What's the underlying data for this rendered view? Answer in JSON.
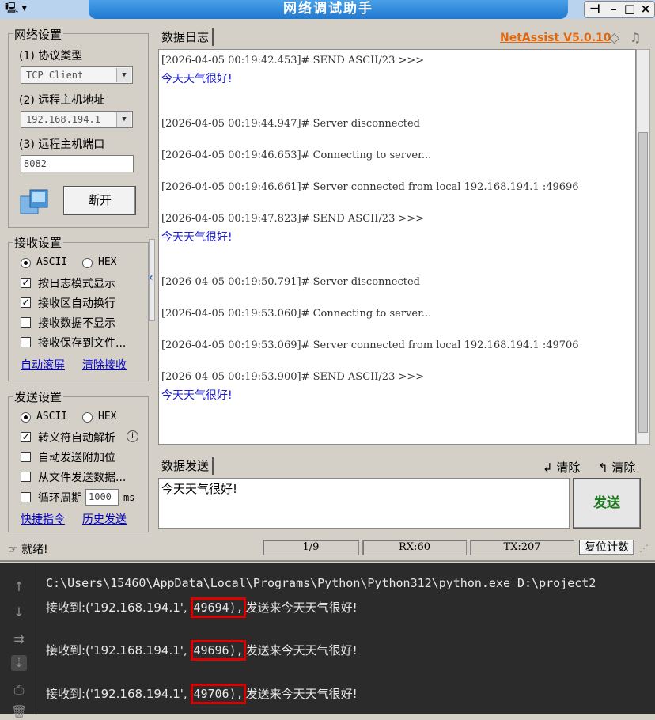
{
  "window": {
    "title": "网络调试助手",
    "brand": "NetAssist V5.0.10",
    "sys_menu": "▾",
    "btn_pin": "⊣",
    "btn_min": "–",
    "btn_max": "□",
    "btn_close": "×"
  },
  "network": {
    "legend": "网络设置",
    "protocol_label": "(1) 协议类型",
    "protocol_value": "TCP Client",
    "host_label": "(2) 远程主机地址",
    "host_value": "192.168.194.1",
    "port_label": "(3) 远程主机端口",
    "port_value": "8082",
    "connect_button": "断开"
  },
  "recv": {
    "legend": "接收设置",
    "radio_ascii": "ASCII",
    "radio_hex": "HEX",
    "opt_log_mode": "按日志模式显示",
    "opt_auto_wrap": "接收区自动换行",
    "opt_hide": "接收数据不显示",
    "opt_save_file": "接收保存到文件...",
    "link_autoscroll": "自动滚屏",
    "link_clear": "清除接收"
  },
  "send_settings": {
    "legend": "发送设置",
    "radio_ascii": "ASCII",
    "radio_hex": "HEX",
    "opt_escape": "转义符自动解析",
    "opt_append": "自动发送附加位",
    "opt_from_file": "从文件发送数据...",
    "opt_loop": "循环周期",
    "loop_value": "1000",
    "loop_unit": "ms",
    "link_shortcuts": "快捷指令",
    "link_history": "历史发送"
  },
  "log": {
    "tab": "数据日志",
    "entries": [
      {
        "meta": "[2026-04-05 00:19:42.453]# SEND ASCII/23 >>>",
        "msg": "今天天气很好!"
      },
      {
        "meta": "[2026-04-05 00:19:44.947]# Server disconnected"
      },
      {
        "meta": "[2026-04-05 00:19:46.653]# Connecting to server..."
      },
      {
        "meta": "[2026-04-05 00:19:46.661]# Server connected from local 192.168.194.1 :49696"
      },
      {
        "meta": "[2026-04-05 00:19:47.823]# SEND ASCII/23 >>>",
        "msg": "今天天气很好!"
      },
      {
        "meta": "[2026-04-05 00:19:50.791]# Server disconnected"
      },
      {
        "meta": "[2026-04-05 00:19:53.060]# Connecting to server..."
      },
      {
        "meta": "[2026-04-05 00:19:53.069]# Server connected from local 192.168.194.1 :49706"
      },
      {
        "meta": "[2026-04-05 00:19:53.900]# SEND ASCII/23 >>>",
        "msg": "今天天气很好!"
      }
    ]
  },
  "sendarea": {
    "tab": "数据发送",
    "clear1": "清除",
    "clear2": "清除",
    "text": "今天天气很好!",
    "send_button": "发送"
  },
  "status": {
    "ready": "就绪!",
    "count": "1/9",
    "rx": "RX:60",
    "tx": "TX:207",
    "reset": "复位计数"
  },
  "console": {
    "cmd": "C:\\Users\\15460\\AppData\\Local\\Programs\\Python\\Python312\\python.exe D:\\project2",
    "lines": [
      {
        "prefix": "接收到:('192.168.194.1', ",
        "port": "49694),",
        "suffix": "发送来今天天气很好!"
      },
      {
        "prefix": "接收到:('192.168.194.1', ",
        "port": "49696),",
        "suffix": "发送来今天天气很好!"
      },
      {
        "prefix": "接收到:('192.168.194.1', ",
        "port": "49706),",
        "suffix": "发送来今天天气很好!"
      }
    ],
    "gutter_icons": [
      "arrow-up-icon",
      "arrow-down-icon",
      "wrap-icon",
      "scroll-end-icon",
      "print-icon",
      "trash-icon"
    ]
  }
}
